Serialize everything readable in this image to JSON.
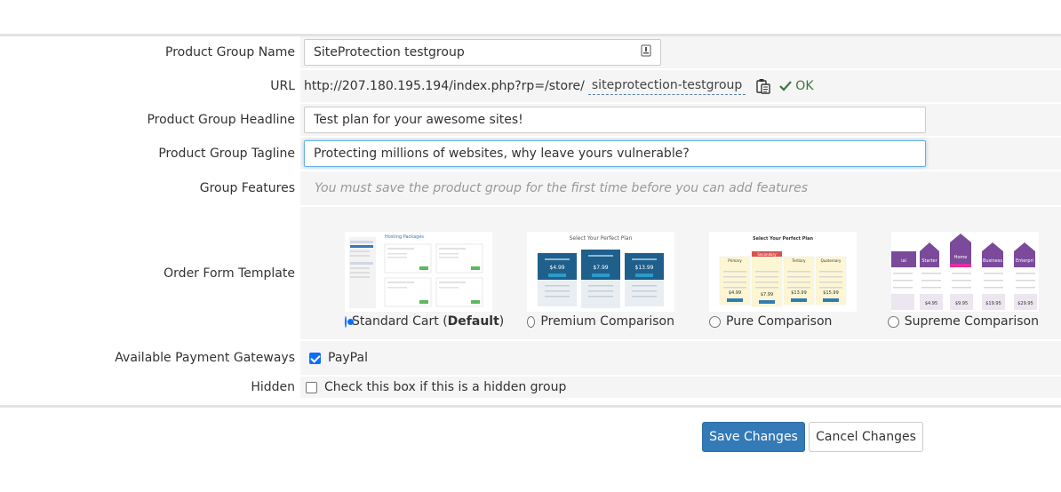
{
  "form": {
    "group_name": {
      "label": "Product Group Name",
      "value": "SiteProtection testgroup"
    },
    "url": {
      "label": "URL",
      "base": "http://207.180.195.194/index.php?rp=/store/",
      "slug": "siteprotection-testgroup",
      "ok_text": "OK"
    },
    "headline": {
      "label": "Product Group Headline",
      "value": "Test plan for your awesome sites!"
    },
    "tagline": {
      "label": "Product Group Tagline",
      "value": "Protecting millions of websites, why leave yours vulnerable?"
    },
    "features": {
      "label": "Group Features",
      "hint": "You must save the product group for the first time before you can add features"
    },
    "template": {
      "label": "Order Form Template",
      "selected": "standard_cart",
      "options": [
        {
          "name": "Standard Cart",
          "suffix": "Default"
        },
        {
          "name": "Premium Comparison"
        },
        {
          "name": "Pure Comparison"
        },
        {
          "name": "Supreme Comparison"
        }
      ],
      "thumbnails": {
        "standard": {
          "heading": "Hosting Packages"
        },
        "premium": {
          "heading": "Select Your Perfect Plan",
          "prices": [
            "$4.99",
            "$7.99",
            "$13.99"
          ]
        },
        "pure": {
          "heading": "Select Your Perfect Plan",
          "cols": [
            "Primary",
            "Secondary",
            "Tertiary",
            "Quaternary"
          ],
          "prices": [
            "$4.99",
            "$7.99",
            "$13.99",
            "$15.99"
          ]
        },
        "supreme": {
          "cols": [
            "ial",
            "Starter",
            "Home",
            "Business",
            "Enterpri"
          ],
          "prices": [
            "$4.95",
            "$9.95",
            "$19.95",
            "$29.95"
          ]
        }
      }
    },
    "payment": {
      "label": "Available Payment Gateways",
      "gateway": "PayPal",
      "checked": true
    },
    "hidden": {
      "label": "Hidden",
      "text": "Check this box if this is a hidden group",
      "checked": false
    }
  },
  "buttons": {
    "save": "Save Changes",
    "cancel": "Cancel Changes"
  },
  "colors": {
    "primary": "#337ab7",
    "ok": "#3c763d",
    "row_bg": "#f5f5f5",
    "supreme_purple": "#6f3a8c"
  }
}
